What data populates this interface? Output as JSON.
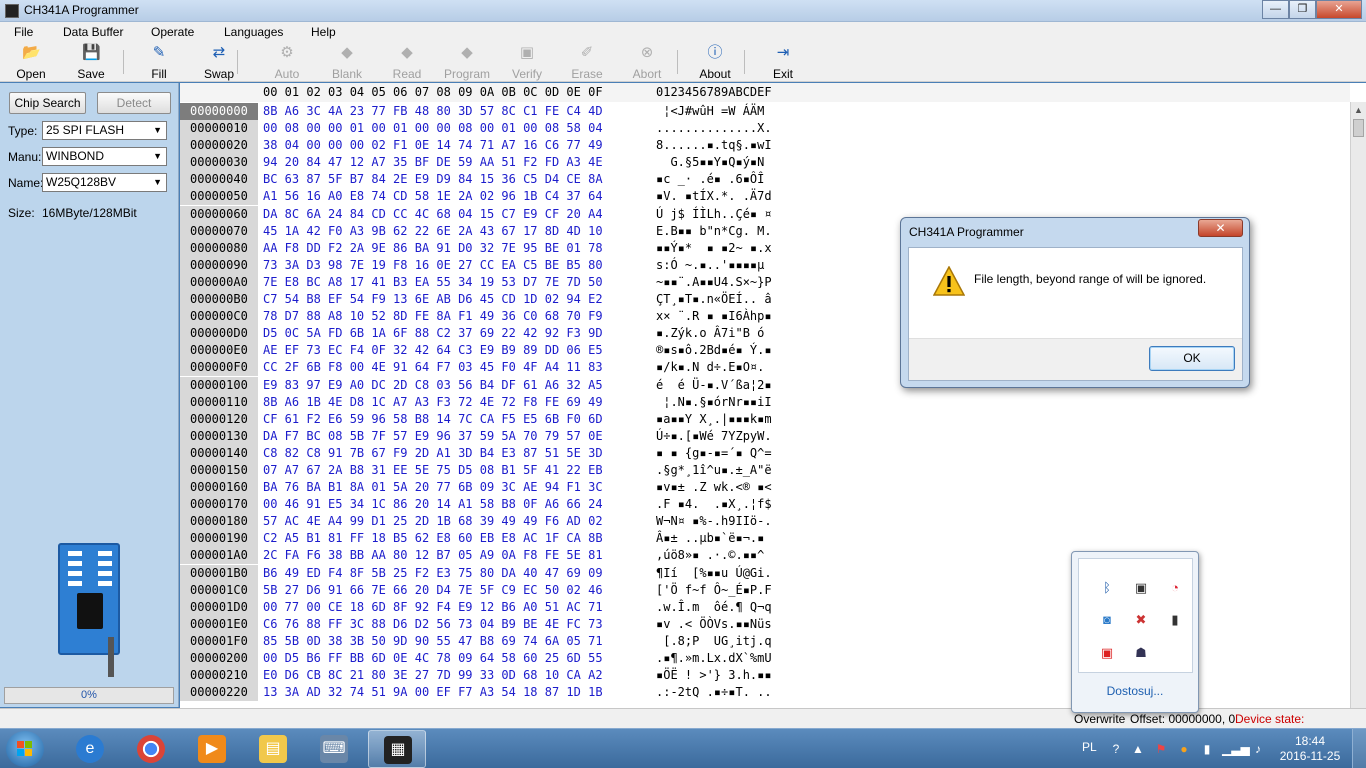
{
  "window": {
    "title": "CH341A Programmer",
    "min": "—",
    "max": "❐",
    "close": "✕"
  },
  "menu": [
    "File",
    "Data Buffer",
    "Operate",
    "Languages",
    "Help"
  ],
  "toolbar": [
    {
      "label": "Open",
      "icon": "open-folder-icon",
      "glyph": "📂",
      "enabled": true
    },
    {
      "label": "Save",
      "icon": "save-disk-icon",
      "glyph": "💾",
      "enabled": true
    },
    {
      "label": "Fill",
      "icon": "fill-edit-icon",
      "glyph": "✎",
      "enabled": true
    },
    {
      "label": "Swap",
      "icon": "swap-arrows-icon",
      "glyph": "⇄",
      "enabled": true
    },
    {
      "label": "Auto",
      "icon": "auto-gear-icon",
      "glyph": "⚙",
      "enabled": false
    },
    {
      "label": "Blank",
      "icon": "blank-chip-icon",
      "glyph": "◆",
      "enabled": false
    },
    {
      "label": "Read",
      "icon": "read-chip-icon",
      "glyph": "◆",
      "enabled": false
    },
    {
      "label": "Program",
      "icon": "program-chip-icon",
      "glyph": "◆",
      "enabled": false
    },
    {
      "label": "Verify",
      "icon": "verify-icon",
      "glyph": "▣",
      "enabled": false
    },
    {
      "label": "Erase",
      "icon": "erase-icon",
      "glyph": "✐",
      "enabled": false
    },
    {
      "label": "Abort",
      "icon": "abort-icon",
      "glyph": "⊗",
      "enabled": false
    },
    {
      "label": "About",
      "icon": "info-icon",
      "glyph": "ⓘ",
      "enabled": true
    },
    {
      "label": "Exit",
      "icon": "exit-icon",
      "glyph": "⇥",
      "enabled": true
    }
  ],
  "left": {
    "chip_search": "Chip Search",
    "detect": "Detect",
    "type_label": "Type:",
    "type_value": "25 SPI FLASH",
    "manu_label": "Manu:",
    "manu_value": "WINBOND",
    "name_label": "Name:",
    "name_value": "W25Q128BV",
    "size_label": "Size:",
    "size_value": "16MByte/128MBit",
    "progress": "0%"
  },
  "hex": {
    "columns": "00 01 02 03 04 05 06 07 08 09 0A 0B 0C 0D 0E 0F",
    "ascii_header": "0123456789ABCDEF",
    "rows": [
      [
        "00000000",
        "8B A6 3C 4A 23 77 FB 48 80 3D 57 8C C1 FE C4 4D",
        " ¦<J#wûH =W ÁÄM"
      ],
      [
        "00000010",
        "00 08 00 00 01 00 01 00 00 08 00 01 00 08 58 04",
        "..............X."
      ],
      [
        "00000020",
        "38 04 00 00 00 02 F1 0E 14 74 71 A7 16 C6 77 49",
        "8......▪.tq§.▪wI"
      ],
      [
        "00000030",
        "94 20 84 47 12 A7 35 BF DE 59 AA 51 F2 FD A3 4E",
        "  G.§5▪▪Y▪Q▪ý▪N"
      ],
      [
        "00000040",
        "BC 63 87 5F B7 84 2E E9 D9 84 15 36 C5 D4 CE 8A",
        "▪c _· .é▪ .6▪ÔÎ"
      ],
      [
        "00000050",
        "A1 56 16 A0 E8 74 CD 58 1E 2A 02 96 1B C4 37 64",
        "▪V. ▪tÍX.*. .Ä7d"
      ],
      [
        "00000060",
        "DA 8C 6A 24 84 CD CC 4C 68 04 15 C7 E9 CF 20 A4",
        "Ú j$ ÍÌLh..Çé▪ ¤"
      ],
      [
        "00000070",
        "45 1A 42 F0 A3 9B 62 22 6E 2A 43 67 17 8D 4D 10",
        "E.B▪▪ b\"n*Cg. M."
      ],
      [
        "00000080",
        "AA F8 DD F2 2A 9E 86 BA 91 D0 32 7E 95 BE 01 78",
        "▪▪Ý▪*  ▪ ▪2~ ▪.x"
      ],
      [
        "00000090",
        "73 3A D3 98 7E 19 F8 16 0E 27 CC EA C5 BE B5 80",
        "s:Ó ~.▪..'▪▪▪▪µ "
      ],
      [
        "000000A0",
        "7E E8 BC A8 17 41 B3 EA 55 34 19 53 D7 7E 7D 50",
        "~▪▪¨.A▪▪U4.S×~}P"
      ],
      [
        "000000B0",
        "C7 54 B8 EF 54 F9 13 6E AB D6 45 CD 1D 02 94 E2",
        "ÇT¸▪T▪.n«ÖEÍ.. â"
      ],
      [
        "000000C0",
        "78 D7 88 A8 10 52 8D FE 8A F1 49 36 C0 68 70 F9",
        "x× ¨.R ▪ ▪I6Àhp▪"
      ],
      [
        "000000D0",
        "D5 0C 5A FD 6B 1A 6F 88 C2 37 69 22 42 92 F3 9D",
        "▪.Zýk.o Â7i\"B ó "
      ],
      [
        "000000E0",
        "AE EF 73 EC F4 0F 32 42 64 C3 E9 B9 89 DD 06 E5",
        "®▪s▪ô.2Bd▪é▪ Ý.▪"
      ],
      [
        "000000F0",
        "CC 2F 6B F8 00 4E 91 64 F7 03 45 F0 4F A4 11 83",
        "▪/k▪.N d÷.E▪O¤. "
      ],
      [
        "00000100",
        "E9 83 97 E9 A0 DC 2D C8 03 56 B4 DF 61 A6 32 A5",
        "é  é Ü-▪.V´ßa¦2▪"
      ],
      [
        "00000110",
        "8B A6 1B 4E D8 1C A7 A3 F3 72 4E 72 F8 FE 69 49",
        " ¦.N▪.§▪órNr▪▪iI"
      ],
      [
        "00000120",
        "CF 61 F2 E6 59 96 58 B8 14 7C CA F5 E5 6B F0 6D",
        "▪a▪▪Y X¸.|▪▪▪k▪m"
      ],
      [
        "00000130",
        "DA F7 BC 08 5B 7F 57 E9 96 37 59 5A 70 79 57 0E",
        "Ú÷▪.[▪Wé 7YZpyW."
      ],
      [
        "00000140",
        "C8 82 C8 91 7B 67 F9 2D A1 3D B4 E3 87 51 5E 3D",
        "▪ ▪ {g▪-▪=´▪ Q^="
      ],
      [
        "00000150",
        "07 A7 67 2A B8 31 EE 5E 75 D5 08 B1 5F 41 22 EB",
        ".§g*¸1î^u▪.±_A\"ë"
      ],
      [
        "00000160",
        "BA 76 BA B1 8A 01 5A 20 77 6B 09 3C AE 94 F1 3C",
        "▪v▪± .Z wk.<® ▪<"
      ],
      [
        "00000170",
        "00 46 91 E5 34 1C 86 20 14 A1 58 B8 0F A6 66 24",
        ".F ▪4.  .▪X¸.¦f$"
      ],
      [
        "00000180",
        "57 AC 4E A4 99 D1 25 2D 1B 68 39 49 49 F6 AD 02",
        "W¬N¤ ▪%-.h9IIö-."
      ],
      [
        "00000190",
        "C2 A5 B1 81 FF 18 B5 62 E8 60 EB E8 AC 1F CA 8B",
        "Â▪± ..µb▪`ë▪¬.▪ "
      ],
      [
        "000001A0",
        "2C FA F6 38 BB AA 80 12 B7 05 A9 0A F8 FE 5E 81",
        ",úö8»▪ .·.©.▪▪^ "
      ],
      [
        "000001B0",
        "B6 49 ED F4 8F 5B 25 F2 E3 75 80 DA 40 47 69 09",
        "¶Ií  [%▪▪u Ú@Gi."
      ],
      [
        "000001C0",
        "5B 27 D6 91 66 7E 66 20 D4 7E 5F C9 EC 50 02 46",
        "['Ö f~f Ô~_É▪P.F"
      ],
      [
        "000001D0",
        "00 77 00 CE 18 6D 8F 92 F4 E9 12 B6 A0 51 AC 71",
        ".w.Î.m  ôé.¶ Q¬q"
      ],
      [
        "000001E0",
        "C6 76 88 FF 3C 88 D6 D2 56 73 04 B9 BE 4E FC 73",
        "▪v .< ÖÒVs.▪▪Nüs"
      ],
      [
        "000001F0",
        "85 5B 0D 38 3B 50 9D 90 55 47 B8 69 74 6A 05 71",
        " [.8;P  UG¸itj.q"
      ],
      [
        "00000200",
        "00 D5 B6 FF BB 6D 0E 4C 78 09 64 58 60 25 6D 55",
        ".▪¶.»m.Lx.dX`%mU"
      ],
      [
        "00000210",
        "E0 D6 CB 8C 21 80 3E 27 7D 99 33 0D 68 10 CA A2",
        "▪ÖË ! >'} 3.h.▪▪"
      ],
      [
        "00000220",
        "13 3A AD 32 74 51 9A 00 EF F7 A3 54 18 87 1D 1B",
        ".:-2tQ .▪÷▪T. .."
      ]
    ]
  },
  "status": {
    "mode": "Overwrite",
    "offset": "Offset: 00000000, 0",
    "device": "Device state: NotConnect."
  },
  "dialog": {
    "title": "CH341A Programmer",
    "message": "File length, beyond range of will be ignored.",
    "ok": "OK",
    "close": "✕"
  },
  "tray_popup": {
    "customize": "Dostosuj..."
  },
  "taskbar": {
    "lang": "PL",
    "time": "18:44",
    "date": "2016-11-25"
  }
}
